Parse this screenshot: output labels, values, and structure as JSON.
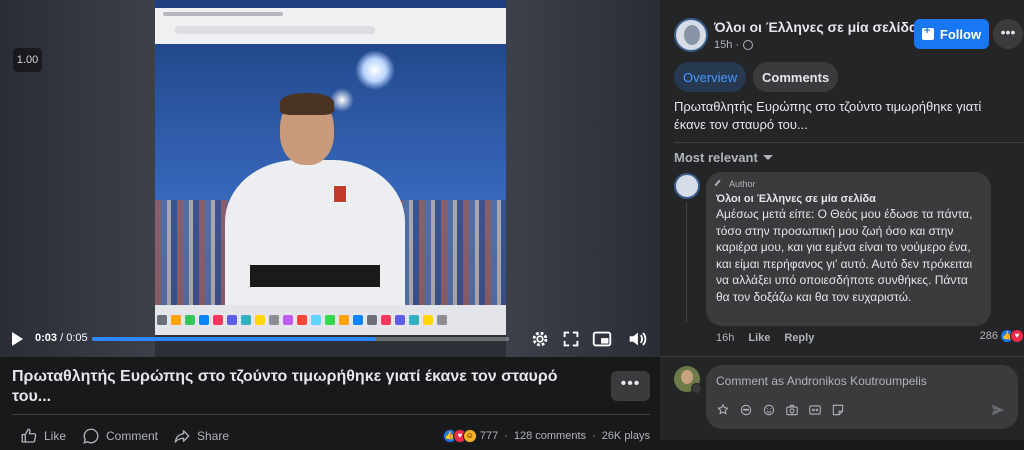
{
  "video": {
    "speed_badge": "1.00",
    "time_current": "0:03",
    "time_separator": " / ",
    "time_total": "0:05",
    "progress_fraction": 0.68
  },
  "post": {
    "title": "Πρωταθλητής Ευρώπης στο τζούντο τιμωρήθηκε γιατί έκανε τον σταυρό του...",
    "actions": {
      "like": "Like",
      "comment": "Comment",
      "share": "Share"
    },
    "reaction_count": "777",
    "comments_count": "128 comments",
    "plays": "26K plays"
  },
  "page": {
    "name": "Όλοι οι Έλληνες σε μία σελίδα",
    "time": "15h",
    "follow_label": "Follow"
  },
  "tabs": {
    "overview": "Overview",
    "comments": "Comments"
  },
  "description": "Πρωταθλητής Ευρώπης στο τζούντο τιμωρήθηκε γιατί έκανε τον σταυρό του...",
  "sort_label": "Most relevant",
  "comment": {
    "author_badge": "Author",
    "name": "Όλοι οι Έλληνες σε μία σελίδα",
    "text": "Αμέσως μετά είπε: Ο Θεός μου έδωσε τα πάντα, τόσο στην προσωπική μου ζωή όσο και στην καριέρα μου, και για εμένα είναι το νούμερο ένα, και είμαι περήφανος γι' αυτό. Αυτό δεν πρόκειται να αλλάξει υπό οποιεσδήποτε συνθήκες. Πάντα θα τον δοξάζω και θα τον ευχαριστώ.",
    "time": "16h",
    "like": "Like",
    "reply": "Reply",
    "reactions": "286"
  },
  "composer": {
    "placeholder": "Comment as Andronikos Koutroumpelis"
  },
  "colors": {
    "accent": "#1877f2",
    "background": "#18191a",
    "panel": "#242526",
    "bubble": "#3a3b3c"
  }
}
